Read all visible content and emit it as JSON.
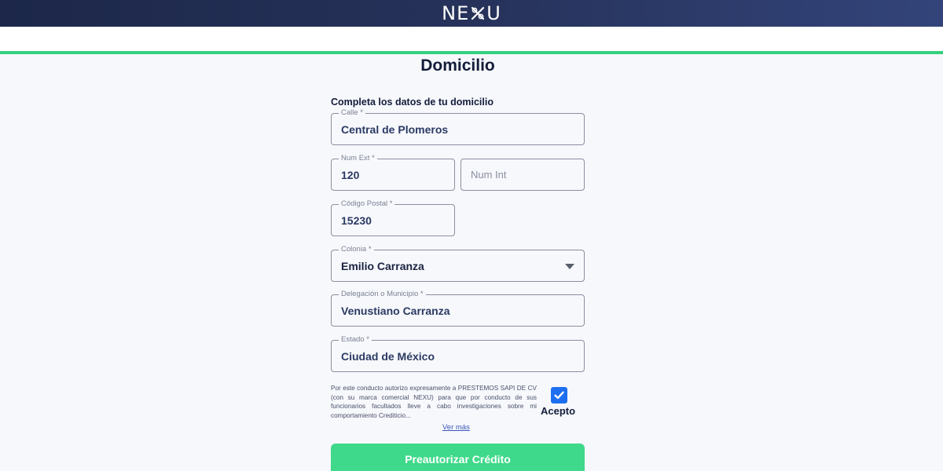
{
  "header": {
    "logo_text_left": "NE",
    "logo_text_right": "U",
    "logo_mark_icon": "nexu-x-mark"
  },
  "page": {
    "title": "Domicilio",
    "subtitle": "Completa los datos de tu domicilio"
  },
  "form": {
    "calle": {
      "label": "Calle *",
      "value": "Central de Plomeros"
    },
    "num_ext": {
      "label": "Num Ext *",
      "value": "120"
    },
    "num_int": {
      "placeholder": "Num Int"
    },
    "codigo_postal": {
      "label": "Código Postal *",
      "value": "15230"
    },
    "colonia": {
      "label": "Colonia *",
      "value": "Emilio Carranza"
    },
    "delegacion": {
      "label": "Delegación o Municipio *",
      "value": "Venustiano Carranza"
    },
    "estado": {
      "label": "Estado *",
      "value": "Ciudad de México"
    }
  },
  "consent": {
    "text": "Por este conducto autorizo expresamente a PRESTEMOS SAPI DE CV (con su marca comercial NEXU) para que por conducto de sus funcionarios facultados lleve a cabo investigaciones sobre mi comportamiento Crediticio...",
    "more_link": "Ver más",
    "checkbox_checked": true,
    "checkbox_label": "Acepto"
  },
  "cta": {
    "label": "Preautorizar Crédito"
  },
  "colors": {
    "header_dark": "#1c2749",
    "accent_green": "#34d07e",
    "button_green": "#3ed98a",
    "checkbox_blue": "#1e6ff0",
    "text_dark": "#141c3a"
  }
}
